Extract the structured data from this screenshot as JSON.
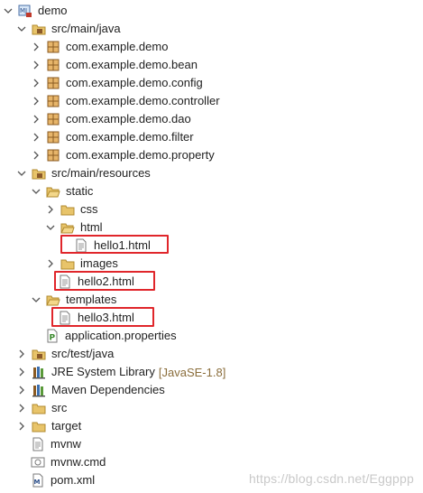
{
  "tree": {
    "root": "demo",
    "main_java": "src/main/java",
    "packages": [
      "com.example.demo",
      "com.example.demo.bean",
      "com.example.demo.config",
      "com.example.demo.controller",
      "com.example.demo.dao",
      "com.example.demo.filter",
      "com.example.demo.property"
    ],
    "main_resources": "src/main/resources",
    "static": "static",
    "css": "css",
    "html": "html",
    "hello1": "hello1.html",
    "images": "images",
    "hello2": "hello2.html",
    "templates": "templates",
    "hello3": "hello3.html",
    "app_props": "application.properties",
    "test_java": "src/test/java",
    "jre": "JRE System Library",
    "jre_decor": "[JavaSE-1.8]",
    "maven": "Maven Dependencies",
    "src": "src",
    "target": "target",
    "mvnw": "mvnw",
    "mvnw_cmd": "mvnw.cmd",
    "pom": "pom.xml"
  },
  "watermark": "https://blog.csdn.net/Eggppp",
  "colors": {
    "highlight": "#e0262b",
    "folder": "#e8c46a",
    "package": "#b07a3b"
  }
}
